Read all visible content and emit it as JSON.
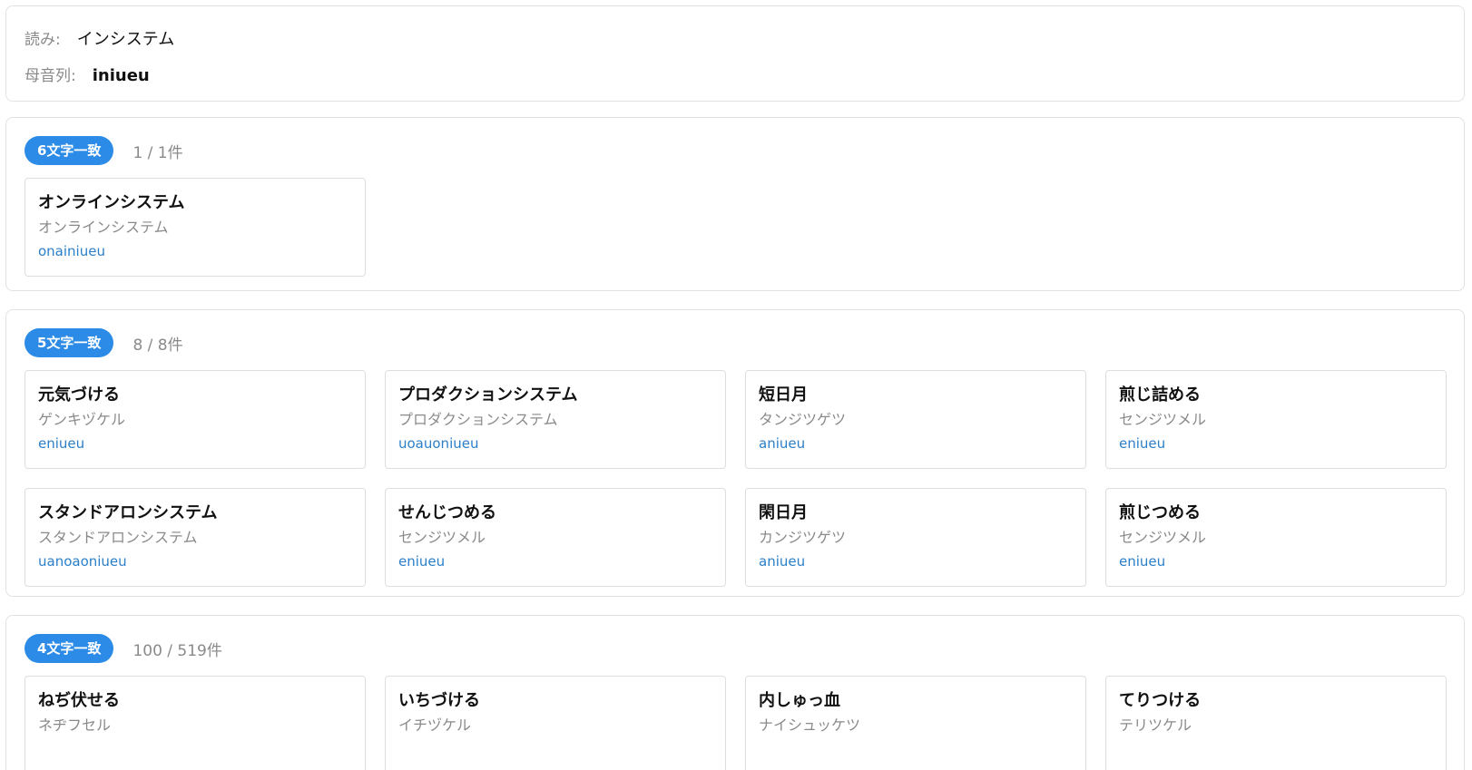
{
  "query": {
    "reading_label": "読み:",
    "reading_value": "インシステム",
    "vowel_label": "母音列:",
    "vowel_value": "iniueu"
  },
  "groups": [
    {
      "badge": "6文字一致",
      "count": "1 / 1件",
      "items": [
        {
          "word": "オンラインシステム",
          "reading": "オンラインシステム",
          "vowels": "onainiueu"
        }
      ]
    },
    {
      "badge": "5文字一致",
      "count": "8 / 8件",
      "items": [
        {
          "word": "元気づける",
          "reading": "ゲンキヅケル",
          "vowels": "eniueu"
        },
        {
          "word": "プロダクションシステム",
          "reading": "プロダクションシステム",
          "vowels": "uoauoniueu"
        },
        {
          "word": "短日月",
          "reading": "タンジツゲツ",
          "vowels": "aniueu"
        },
        {
          "word": "煎じ詰める",
          "reading": "センジツメル",
          "vowels": "eniueu"
        },
        {
          "word": "スタンドアロンシステム",
          "reading": "スタンドアロンシステム",
          "vowels": "uanoaoniueu"
        },
        {
          "word": "せんじつめる",
          "reading": "センジツメル",
          "vowels": "eniueu"
        },
        {
          "word": "閑日月",
          "reading": "カンジツゲツ",
          "vowels": "aniueu"
        },
        {
          "word": "煎じつめる",
          "reading": "センジツメル",
          "vowels": "eniueu"
        }
      ]
    },
    {
      "badge": "4文字一致",
      "count": "100 / 519件",
      "items": [
        {
          "word": "ねぢ伏せる",
          "reading": "ネヂフセル"
        },
        {
          "word": "いちづける",
          "reading": "イチヅケル"
        },
        {
          "word": "内しゅっ血",
          "reading": "ナイシュッケツ"
        },
        {
          "word": "てりつける",
          "reading": "テリツケル"
        }
      ]
    }
  ]
}
